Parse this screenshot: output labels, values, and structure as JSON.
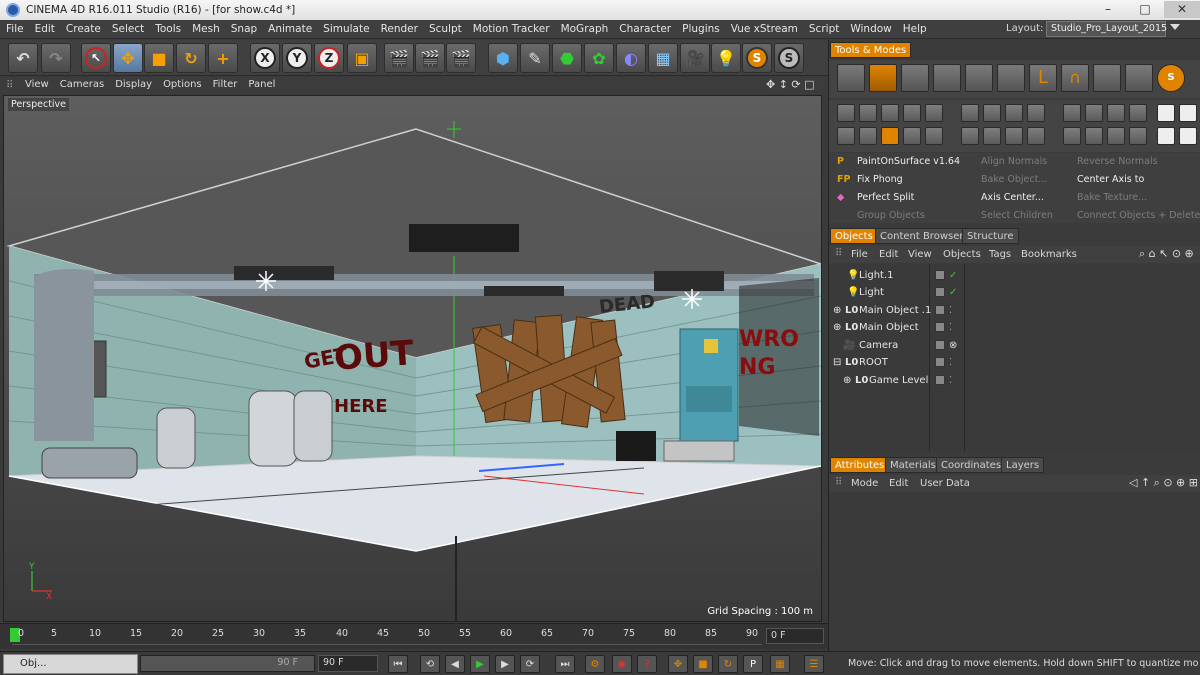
{
  "title": "CINEMA 4D R16.011 Studio (R16) - [for show.c4d *]",
  "window_controls": {
    "minimize": "–",
    "maximize": "□",
    "close": "✕"
  },
  "menu": [
    "File",
    "Edit",
    "Create",
    "Select",
    "Tools",
    "Mesh",
    "Snap",
    "Animate",
    "Simulate",
    "Render",
    "Sculpt",
    "Motion Tracker",
    "MoGraph",
    "Character",
    "Plugins",
    "Vue xStream",
    "Script",
    "Window",
    "Help"
  ],
  "layout": {
    "label": "Layout:",
    "value": "Studio_Pro_Layout_2015"
  },
  "toolbar_axes": [
    "X",
    "Y",
    "Z"
  ],
  "viewport_menu": [
    "View",
    "Cameras",
    "Display",
    "Options",
    "Filter",
    "Panel"
  ],
  "viewport": {
    "label": "Perspective",
    "grid_spacing": "Grid Spacing : 100 m",
    "graffiti": [
      "GET",
      "OUT",
      "HERE",
      "DEAD",
      "WRONG"
    ]
  },
  "tools_modes": {
    "tab": "Tools & Modes"
  },
  "plugins": [
    {
      "label": "PaintOnSurface v1.64",
      "dim": false
    },
    {
      "label": "Align Normals",
      "dim": true
    },
    {
      "label": "Reverse Normals",
      "dim": true
    },
    {
      "label": "Fix Phong",
      "dim": false
    },
    {
      "label": "Bake Object...",
      "dim": true
    },
    {
      "label": "Center Axis to",
      "dim": false
    },
    {
      "label": "Perfect Split",
      "dim": false
    },
    {
      "label": "Axis Center...",
      "dim": false
    },
    {
      "label": "Bake Texture...",
      "dim": true
    },
    {
      "label": "Group Objects",
      "dim": true
    },
    {
      "label": "Select Children",
      "dim": true
    },
    {
      "label": "Connect Objects + Delete",
      "dim": true
    }
  ],
  "object_tabs": [
    "Objects",
    "Content Browser",
    "Structure"
  ],
  "object_menu": [
    "File",
    "Edit",
    "View",
    "Objects",
    "Tags",
    "Bookmarks"
  ],
  "objects": [
    {
      "name": "Light.1",
      "indent": 1
    },
    {
      "name": "Light",
      "indent": 1
    },
    {
      "name": "Main Object .1",
      "indent": 0
    },
    {
      "name": "Main Object",
      "indent": 0
    },
    {
      "name": "Camera",
      "indent": 1
    },
    {
      "name": "ROOT",
      "indent": 0
    },
    {
      "name": "Game Level",
      "indent": 1
    }
  ],
  "attr_tabs": [
    "Attributes",
    "Materials",
    "Coordinates",
    "Layers"
  ],
  "attr_menu": [
    "Mode",
    "Edit",
    "User Data"
  ],
  "timeline": {
    "ticks": [
      "0",
      "5",
      "10",
      "15",
      "20",
      "25",
      "30",
      "35",
      "40",
      "45",
      "50",
      "55",
      "60",
      "65",
      "70",
      "75",
      "80",
      "85",
      "90"
    ],
    "current_frame": "0 F"
  },
  "bottom": {
    "obj_tab": "Obj...",
    "end_frame": "90 F",
    "end_frame2": "90 F",
    "status": "Move: Click and drag to move elements. Hold down SHIFT to quantize movement"
  },
  "colors": {
    "accent": "#e08400",
    "axis_x": "#d33",
    "axis_y": "#3c3",
    "axis_z": "#36f"
  }
}
